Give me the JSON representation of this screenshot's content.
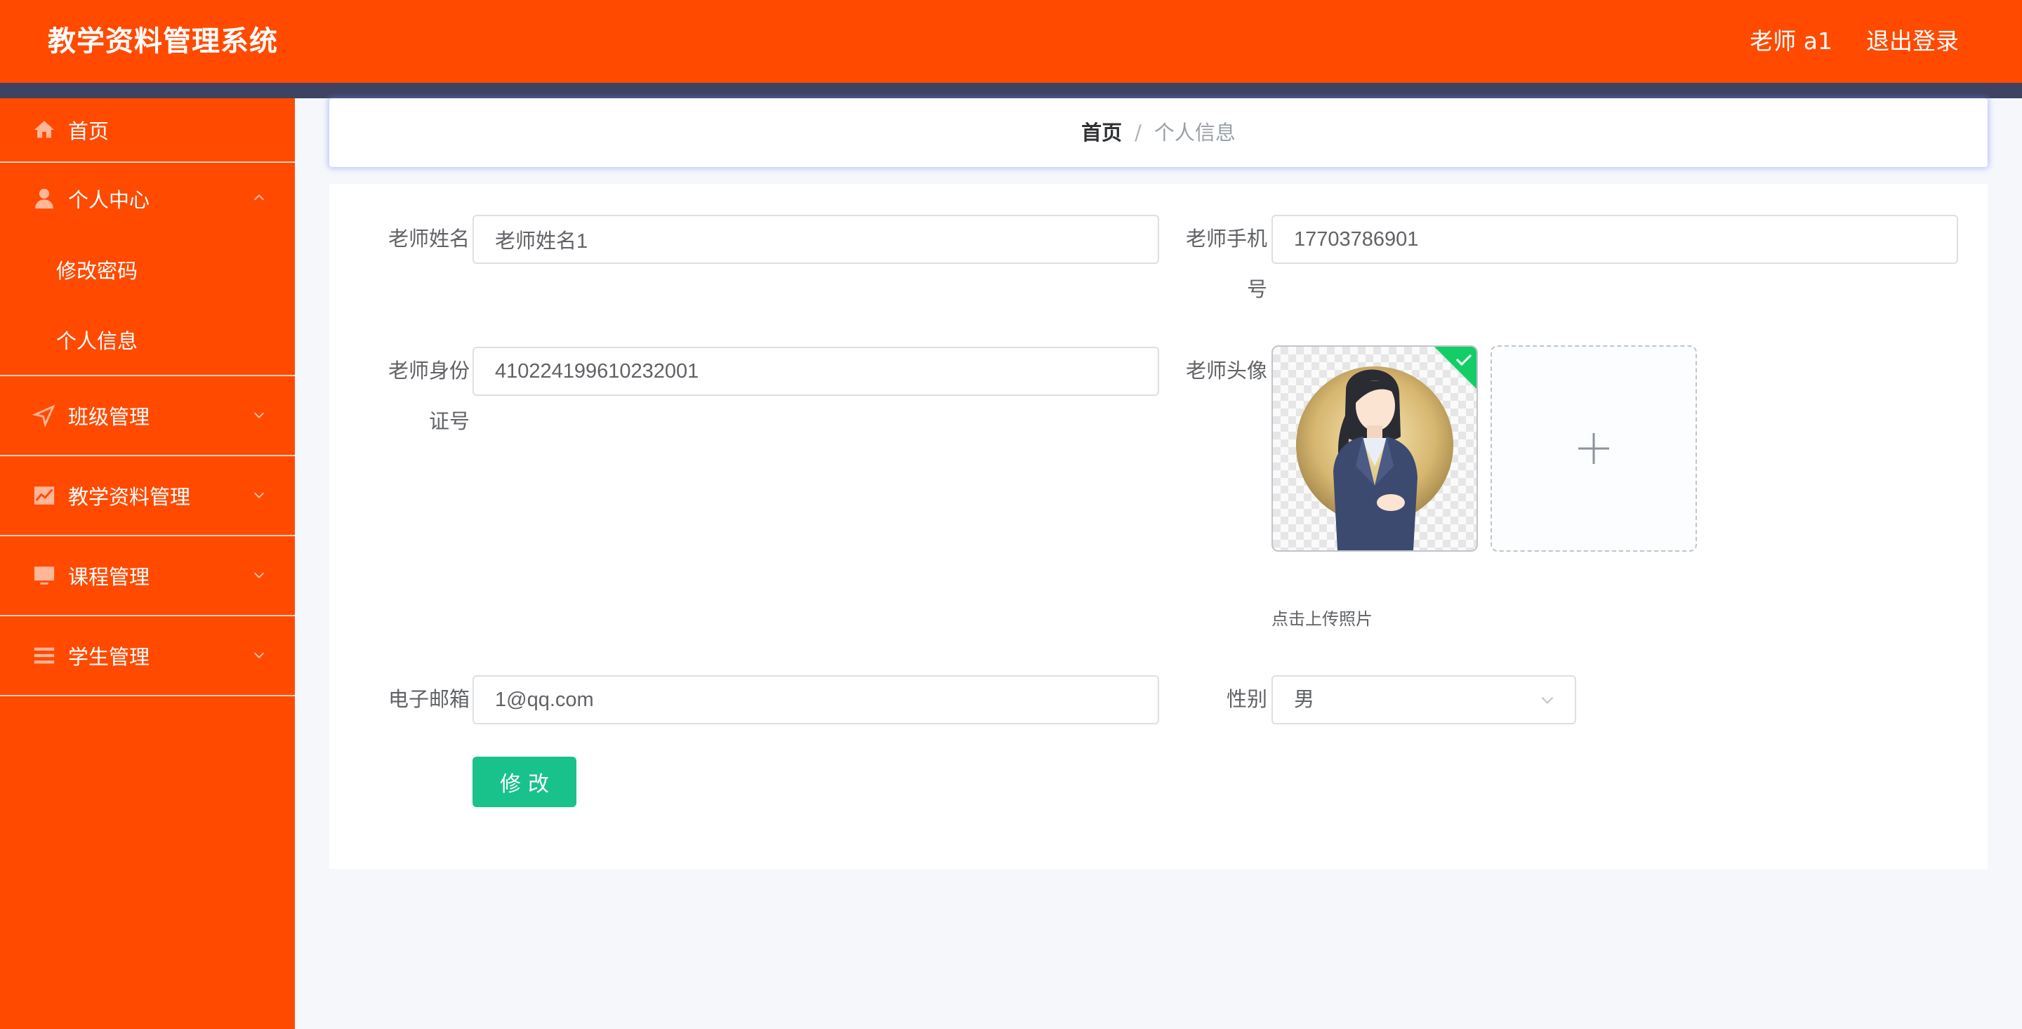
{
  "header": {
    "title": "教学资料管理系统",
    "user": "老师 a1",
    "logout": "退出登录"
  },
  "sidebar": {
    "items": [
      {
        "label": "首页",
        "icon": "home-icon"
      },
      {
        "label": "个人中心",
        "icon": "user-icon",
        "expanded": true,
        "children": [
          {
            "label": "修改密码"
          },
          {
            "label": "个人信息"
          }
        ]
      },
      {
        "label": "班级管理",
        "icon": "send-icon"
      },
      {
        "label": "教学资料管理",
        "icon": "chart-icon"
      },
      {
        "label": "课程管理",
        "icon": "monitor-icon"
      },
      {
        "label": "学生管理",
        "icon": "list-icon"
      }
    ]
  },
  "breadcrumb": {
    "home": "首页",
    "separator": "/",
    "current": "个人信息"
  },
  "form": {
    "name_label": "老师姓名",
    "name_value": "老师姓名1",
    "phone_label_line1": "老师手机",
    "phone_label_line2": "号",
    "phone_value": "17703786901",
    "id_label_line1": "老师身份",
    "id_label_line2": "证号",
    "id_value": "410224199610232001",
    "avatar_label": "老师头像",
    "upload_hint": "点击上传照片",
    "email_label": "电子邮箱",
    "email_value": "1@qq.com",
    "gender_label": "性别",
    "gender_value": "男",
    "submit_label": "修改"
  },
  "colors": {
    "primary": "#ff4a00",
    "darkbar": "#3e4361",
    "success": "#19c28a",
    "upload_badge": "#13ce66"
  }
}
